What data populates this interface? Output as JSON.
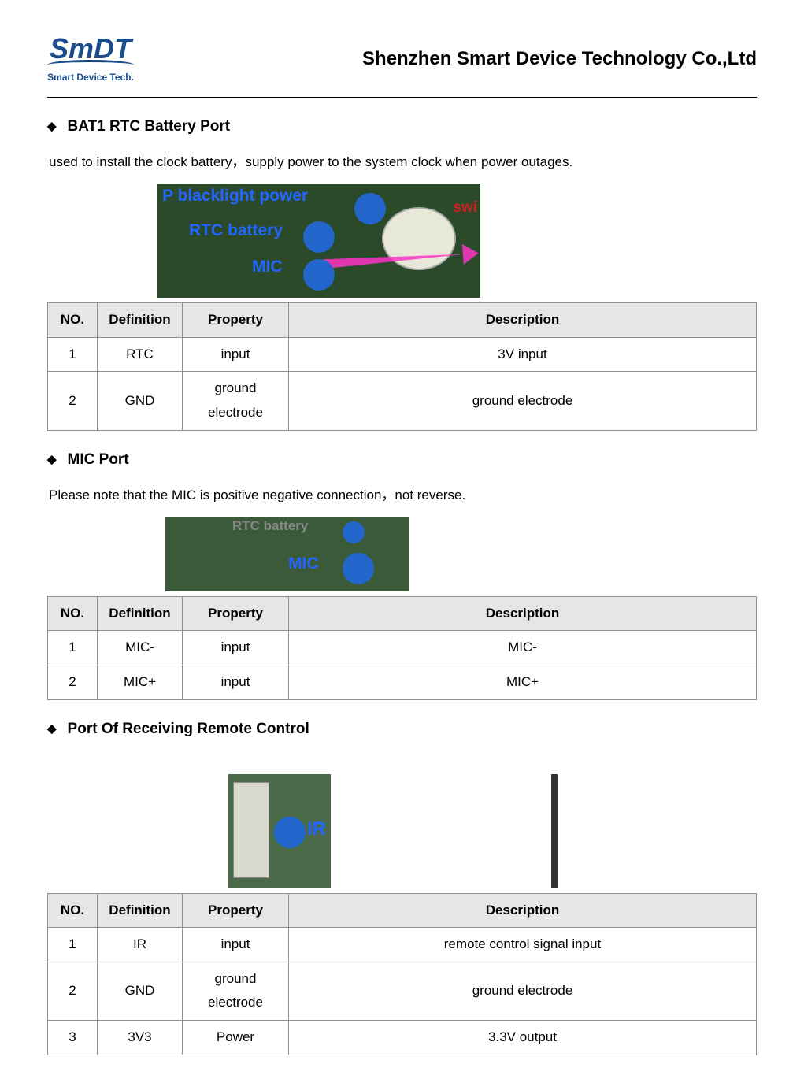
{
  "header": {
    "logo_main": "SmDT",
    "logo_sub": "Smart  Device Tech.",
    "company": "Shenzhen Smart Device Technology Co.,Ltd"
  },
  "table_headers": {
    "no": "NO.",
    "definition": "Definition",
    "property": "Property",
    "description": "Description"
  },
  "sections": [
    {
      "title": "BAT1 RTC Battery Port",
      "desc": "used to install the clock battery，supply power to the system clock when power outages.",
      "image_labels": {
        "l1": "P blacklight power",
        "l2": "RTC battery",
        "l3": "MIC",
        "l4": "swi"
      },
      "rows": [
        {
          "no": "1",
          "def": "RTC",
          "prop": "input",
          "desc": "3V input"
        },
        {
          "no": "2",
          "def": "GND",
          "prop": "ground electrode",
          "desc": "ground electrode"
        }
      ]
    },
    {
      "title": "MIC Port",
      "desc": "Please note that the MIC is positive negative connection，not reverse.",
      "image_labels": {
        "l1": "RTC battery",
        "l2": "MIC"
      },
      "rows": [
        {
          "no": "1",
          "def": "MIC-",
          "prop": "input",
          "desc": "MIC-"
        },
        {
          "no": "2",
          "def": "MIC+",
          "prop": "input",
          "desc": "MIC+"
        }
      ]
    },
    {
      "title": "Port Of Receiving Remote Control",
      "desc": "",
      "image_labels": {
        "l1": "IR"
      },
      "rows": [
        {
          "no": "1",
          "def": "IR",
          "prop": "input",
          "desc": "remote control signal input"
        },
        {
          "no": "2",
          "def": "GND",
          "prop": "ground electrode",
          "desc": "ground electrode"
        },
        {
          "no": "3",
          "def": "3V3",
          "prop": "Power",
          "desc": "3.3V output"
        }
      ]
    }
  ]
}
